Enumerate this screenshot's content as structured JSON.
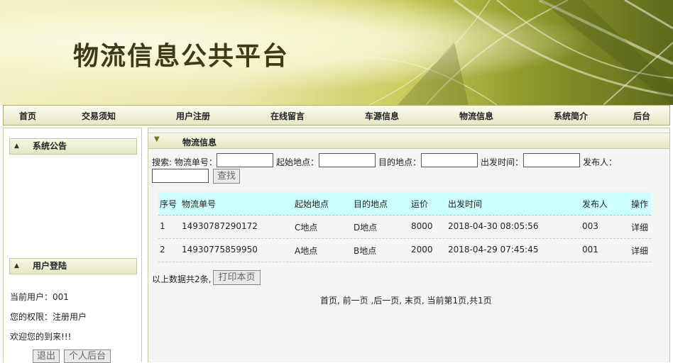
{
  "site": {
    "title": "物流信息公共平台"
  },
  "nav": [
    "首页",
    "交易须知",
    "用户注册",
    "在线留言",
    "车源信息",
    "物流信息",
    "系统简介",
    "后台"
  ],
  "sidebar": {
    "notice_title": "系统公告",
    "login_title": "用户登陆",
    "current_user": "当前用户：001",
    "permission": "您的权限：注册用户",
    "welcome": "欢迎您的到来!!!",
    "logout_label": "退出",
    "personal_label": "个人后台"
  },
  "main": {
    "title": "物流信息",
    "search": {
      "prefix": "搜索: 物流单号：",
      "origin_label": "起始地点：",
      "dest_label": "目的地点：",
      "depart_label": "出发时间：",
      "publisher_label": "发布人：",
      "button": "查找"
    },
    "table": {
      "headers": [
        "序号",
        "物流单号",
        "起始地点",
        "目的地点",
        "运价",
        "出发时间",
        "发布人",
        "操作"
      ],
      "rows": [
        [
          "1",
          "14930787290172",
          "C地点",
          "D地点",
          "8000",
          "2018-04-30 08:05:56",
          "003",
          "详细"
        ],
        [
          "2",
          "14930775859950",
          "A地点",
          "B地点",
          "2000",
          "2018-04-29 07:45:45",
          "001",
          "详细"
        ]
      ]
    },
    "summary": "以上数据共2条,",
    "print_label": "打印本页",
    "pagination": "首页, 前一页 ,后一页, 末页, 当前第1页,共1页"
  }
}
